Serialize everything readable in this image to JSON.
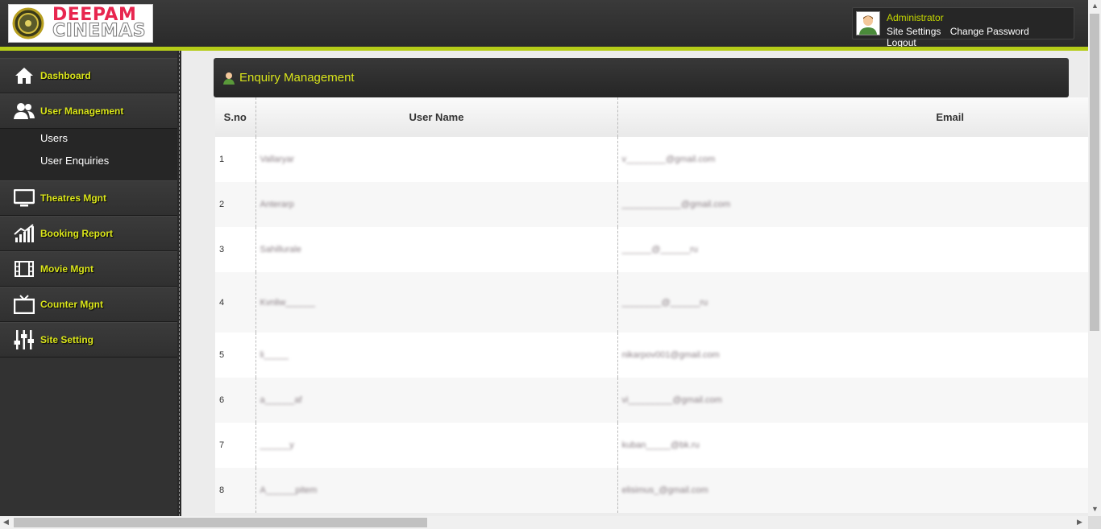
{
  "header": {
    "logo_top": "DEEPAM",
    "logo_bottom": "CINEMAS",
    "accent_color": "#b5cc18",
    "user": {
      "name": "Administrator",
      "links": [
        "Site Settings",
        "Change Password",
        "Logout"
      ]
    }
  },
  "sidebar": {
    "items": [
      {
        "label": "Dashboard",
        "icon": "home-icon"
      },
      {
        "label": "User Management",
        "icon": "users-icon"
      },
      {
        "label": "Theatres Mgnt",
        "icon": "monitor-icon"
      },
      {
        "label": "Booking Report",
        "icon": "bar-chart-icon"
      },
      {
        "label": "Movie Mgnt",
        "icon": "film-icon"
      },
      {
        "label": "Counter Mgnt",
        "icon": "tv-icon"
      },
      {
        "label": "Site Setting",
        "icon": "sliders-icon"
      }
    ],
    "subitems": [
      "Users",
      "User Enquiries"
    ]
  },
  "panel": {
    "title": "Enquiry Management",
    "columns": [
      "S.no",
      "User Name",
      "Email"
    ],
    "rows": [
      {
        "sno": "1",
        "name": "Vallaryar",
        "email": "v________@gmail.com"
      },
      {
        "sno": "2",
        "name": "Anterarp",
        "email": "____________@gmail.com"
      },
      {
        "sno": "3",
        "name": "Sahillurale",
        "email": "______@______ru"
      },
      {
        "sno": "4",
        "name": "Kvnliw______",
        "email": "________@______ru"
      },
      {
        "sno": "5",
        "name": "li_____",
        "email": "nikarpov001@gmail.com"
      },
      {
        "sno": "6",
        "name": "a______af",
        "email": "vi_________@gmail.com"
      },
      {
        "sno": "7",
        "name": "______y",
        "email": "kuban_____@bk.ru"
      },
      {
        "sno": "8",
        "name": "A______pitem",
        "email": "elisimus_@gmail.com"
      }
    ]
  }
}
